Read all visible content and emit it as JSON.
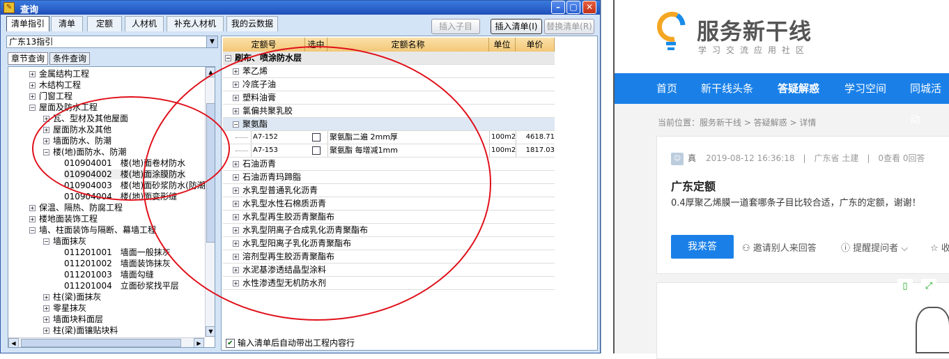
{
  "dialog": {
    "title": "查询",
    "tabs": [
      "清单指引",
      "清单",
      "定额",
      "人材机",
      "补充人材机",
      "我的云数据"
    ],
    "buttons": {
      "insert_child": "插入子目",
      "insert_list": "插入清单(I)",
      "replace_list": "替换清单(R)"
    },
    "combo_value": "广东13指引",
    "subtabs": [
      "章节查询",
      "条件查询"
    ],
    "tree": [
      {
        "label": "金属结构工程",
        "level": 1,
        "mark": "+"
      },
      {
        "label": "木结构工程",
        "level": 1,
        "mark": "+"
      },
      {
        "label": "门窗工程",
        "level": 1,
        "mark": "+"
      },
      {
        "label": "屋面及防水工程",
        "level": 1,
        "mark": "-"
      },
      {
        "label": "瓦、型材及其他屋面",
        "level": 2,
        "mark": "+"
      },
      {
        "label": "屋面防水及其他",
        "level": 2,
        "mark": "+"
      },
      {
        "label": "墙面防水、防潮",
        "level": 2,
        "mark": "+"
      },
      {
        "label": "楼(地)面防水、防潮",
        "level": 2,
        "mark": "-"
      },
      {
        "label": "010904001　楼(地)面卷材防水",
        "level": 3,
        "mark": ""
      },
      {
        "label": "010904002　楼(地)面涂膜防水",
        "level": 3,
        "mark": "",
        "selected": true
      },
      {
        "label": "010904003　楼(地)面砂浆防水(防潮)",
        "level": 3,
        "mark": ""
      },
      {
        "label": "010904004　楼(地)面变形缝",
        "level": 3,
        "mark": ""
      },
      {
        "label": "保温、隔热、防腐工程",
        "level": 1,
        "mark": "+"
      },
      {
        "label": "楼地面装饰工程",
        "level": 1,
        "mark": "+"
      },
      {
        "label": "墙、柱面装饰与隔断、幕墙工程",
        "level": 1,
        "mark": "-"
      },
      {
        "label": "墙面抹灰",
        "level": 2,
        "mark": "-"
      },
      {
        "label": "011201001　墙面一般抹灰",
        "level": 3,
        "mark": ""
      },
      {
        "label": "011201002　墙面装饰抹灰",
        "level": 3,
        "mark": ""
      },
      {
        "label": "011201003　墙面勾缝",
        "level": 3,
        "mark": ""
      },
      {
        "label": "011201004　立面砂浆找平层",
        "level": 3,
        "mark": ""
      },
      {
        "label": "柱(梁)面抹灰",
        "level": 2,
        "mark": "+"
      },
      {
        "label": "零星抹灰",
        "level": 2,
        "mark": "+"
      },
      {
        "label": "墙面块料面层",
        "level": 2,
        "mark": "+"
      },
      {
        "label": "柱(梁)面镶贴块料",
        "level": 2,
        "mark": "+"
      }
    ],
    "grid_headers": [
      "定额号",
      "选中",
      "定额名称",
      "单位",
      "单价"
    ],
    "grid_group": "刷布、喷涂防水层",
    "grid_rows": [
      {
        "type": "cat",
        "label": "苯乙烯",
        "mark": "+"
      },
      {
        "type": "cat",
        "label": "冷底子油",
        "mark": "+"
      },
      {
        "type": "cat",
        "label": "塑料油膏",
        "mark": "+"
      },
      {
        "type": "cat",
        "label": "氯偏共聚乳胶",
        "mark": "+"
      },
      {
        "type": "cat",
        "label": "聚氨酯",
        "mark": "-",
        "highlight": true
      },
      {
        "type": "item",
        "code": "A7-152",
        "name": "聚氨酯二遍 2mm厚",
        "unit": "100m2",
        "price": "4618.71"
      },
      {
        "type": "item",
        "code": "A7-153",
        "name": "聚氨酯 每增减1mm",
        "unit": "100m2",
        "price": "1817.03"
      },
      {
        "type": "cat",
        "label": "石油沥青",
        "mark": "+"
      },
      {
        "type": "cat",
        "label": "石油沥青玛蹄脂",
        "mark": "+"
      },
      {
        "type": "cat",
        "label": "水乳型普通乳化沥青",
        "mark": "+"
      },
      {
        "type": "cat",
        "label": "水乳型水性石棉质沥青",
        "mark": "+"
      },
      {
        "type": "cat",
        "label": "水乳型再生胶沥青聚酯布",
        "mark": "+"
      },
      {
        "type": "cat",
        "label": "水乳型阴离子合成乳化沥青聚酯布",
        "mark": "+"
      },
      {
        "type": "cat",
        "label": "水乳型阳离子乳化沥青聚酯布",
        "mark": "+"
      },
      {
        "type": "cat",
        "label": "溶剂型再生胶沥青聚酯布",
        "mark": "+"
      },
      {
        "type": "cat",
        "label": "水泥基渗透结晶型涂料",
        "mark": "+"
      },
      {
        "type": "cat",
        "label": "水性渗透型无机防水剂",
        "mark": "+"
      }
    ],
    "bottom_checkbox": "输入清单后自动带出工程内容行"
  },
  "site": {
    "brand": "服务新干线",
    "slogan": "学习交流应用社区",
    "nav": [
      "首页",
      "新干线头条",
      "答疑解惑",
      "学习空间",
      "同城活动"
    ],
    "breadcrumb": "当前位置：服务新干线 > 答疑解惑 > 详情",
    "meta": {
      "user": "真",
      "datetime": "2019-08-12 16:36:18",
      "location": "广东省 土建",
      "views": "0查看",
      "answers": "0回答"
    },
    "question_title": "广东定额",
    "question_desc": "0.4厚聚乙烯膜一道套哪条子目比较合适，广东的定额，谢谢！",
    "answer_button": "我来答",
    "invite": "邀请别人来回答",
    "remind": "提醒提问者",
    "collect": "收"
  }
}
